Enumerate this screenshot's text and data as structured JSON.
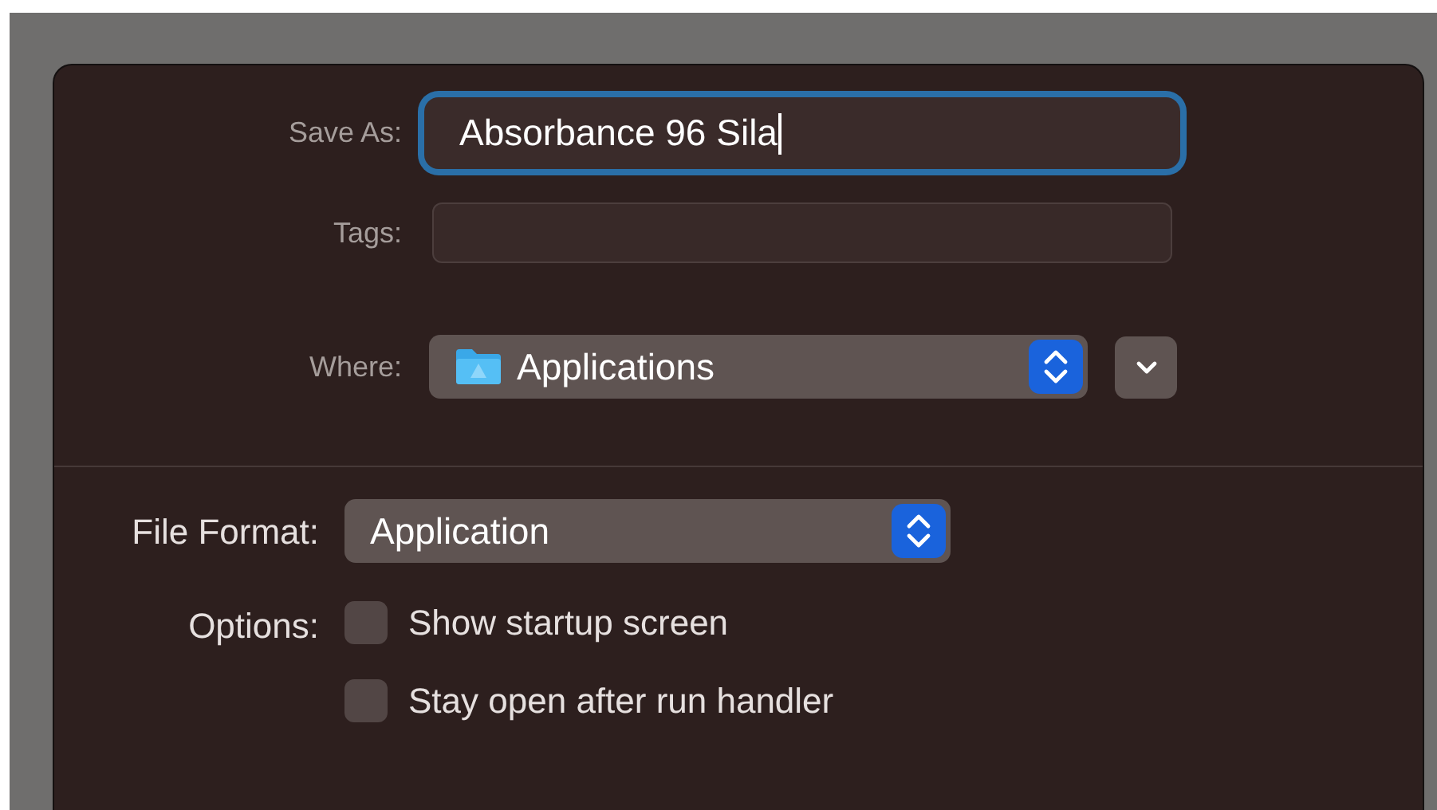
{
  "save_as": {
    "label": "Save As:",
    "value": "Absorbance 96 Sila",
    "focused": true
  },
  "tags": {
    "label": "Tags:"
  },
  "where": {
    "label": "Where:",
    "value": "Applications"
  },
  "file_format": {
    "label": "File Format:",
    "value": "Application"
  },
  "options": {
    "label": "Options:",
    "items": [
      {
        "label": "Show startup screen",
        "checked": false
      },
      {
        "label": "Stay open after run handler",
        "checked": false
      }
    ]
  }
}
